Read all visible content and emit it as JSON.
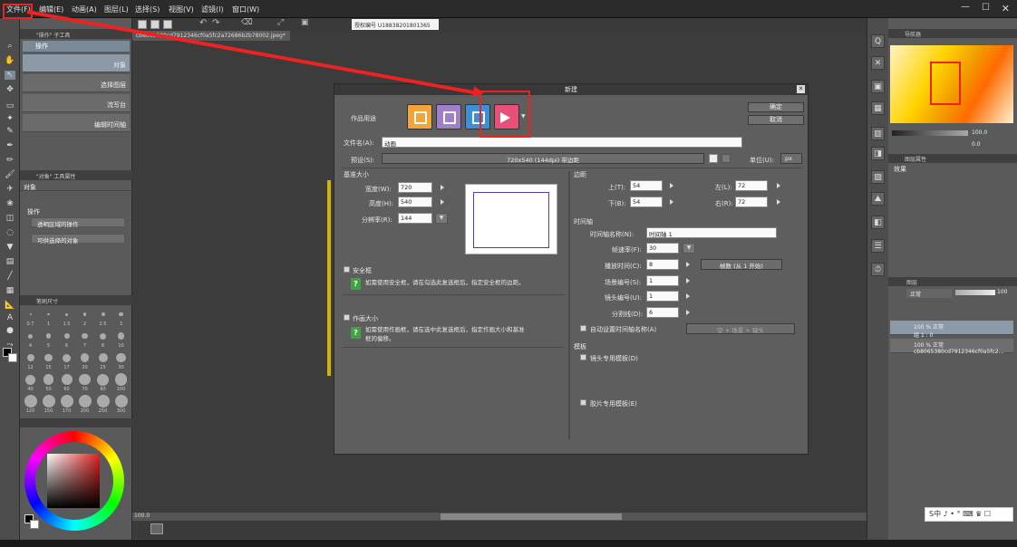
{
  "menubar": {
    "items": [
      "文件(F)",
      "编辑(E)",
      "动画(A)",
      "图层(L)",
      "选择(S)",
      "视图(V)",
      "滤镜(I)",
      "窗口(W)"
    ]
  },
  "toolbar": {
    "field_value": "授权编号 U18838201801365"
  },
  "document": {
    "tab_label": "cb8065380cd7912346cf0a5fc2a72686b2b78002.jpeg*"
  },
  "left_panel": {
    "tool_title": "\"操作\" 子工具",
    "tool_header": "操作",
    "subtools": [
      "对象",
      "选择图层",
      "流写台",
      "编辑时间轴"
    ],
    "property_title": "\"对象\" 工具属性",
    "property_label": "对象",
    "operation_label": "操作",
    "dropdown1": "透明区域的操作",
    "dropdown2": "可供选择的对象",
    "brush_title": "笔刷尺寸",
    "brush_sizes": [
      "0.7",
      "1",
      "1.5",
      "2",
      "2.5",
      "3",
      "4",
      "5",
      "6",
      "7",
      "8",
      "10",
      "12",
      "15",
      "17",
      "20",
      "25",
      "30",
      "40",
      "50",
      "60",
      "70",
      "80",
      "100",
      "120",
      "150",
      "170",
      "200",
      "250",
      "300"
    ]
  },
  "right_panel": {
    "nav_title": "导航器",
    "zoom_value": "100.0",
    "rotate_value": "0.0",
    "effects_title": "图层属性",
    "effects_label": "效果",
    "layers_title": "图层",
    "blend_mode": "正常",
    "opacity": "100",
    "layer1_line1": "100 % 正常",
    "layer1_line2": "组 1 : 0",
    "layer2_line1": "100 % 正常",
    "layer2_line2": "cb8065380cd7912346cf0a5fc2..."
  },
  "dialog": {
    "title": "新建",
    "usage_label": "作品用途",
    "ok_label": "确定",
    "cancel_label": "取消",
    "filename_label": "文件名(A):",
    "filename_value": "动画",
    "preset_label": "预设(S):",
    "preset_value": "720x540 (144dpi) 带边距",
    "unit_label": "单位(U):",
    "unit_value": "px",
    "base_size_title": "基准大小",
    "width_label": "宽度(W):",
    "width_value": "720",
    "height_label": "高度(H):",
    "height_value": "540",
    "resolution_label": "分辨率(R):",
    "resolution_value": "144",
    "margin_title": "边距",
    "top_label": "上(T):",
    "top_value": "54",
    "bottom_label": "下(B):",
    "bottom_value": "54",
    "left_label": "左(L):",
    "left_value": "72",
    "right_label": "右(R):",
    "right_value": "72",
    "timeline_title": "时间轴",
    "timeline_name_label": "时间轴名称(N):",
    "timeline_name_value": "时间轴 1",
    "framerate_label": "帧速率(F):",
    "framerate_value": "30",
    "playtime_label": "播放时间(C):",
    "playtime_value": "8",
    "playtime_unit": "帧数 (从 1 开始)",
    "scene_label": "场景编号(S):",
    "scene_value": "1",
    "cut_label": "镜头编号(U):",
    "cut_value": "1",
    "divide_label": "分割线(D):",
    "divide_value": "6",
    "auto_name_label": "自动设置时间轴名称(A)",
    "auto_name_value": "空 + 场景 + 镜头",
    "safe_area_title": "安全框",
    "safe_area_desc": "如需使用安全框，请在勾选此复选框后，指定安全框的边距。",
    "frame_size_title": "作画大小",
    "frame_size_desc": "如需使用作画框，请在选中此复选框后，指定作画大小和基准框的偏移。",
    "template_title": "模板",
    "template1_label": "镜头专用模板(D)",
    "template2_label": "胶片专用模板(E)"
  },
  "statusbar": {
    "zoom": "100.0"
  },
  "ime": {
    "text": "S中 ♪ • ° ⌨ ♛ ☐"
  },
  "colors": {
    "accent_red": "#e22222",
    "usage_orange": "#f2a33a",
    "usage_purple": "#a07fc8",
    "usage_blue": "#3d8fd6",
    "usage_pink": "#e8507a",
    "help_green": "#3fa343"
  }
}
